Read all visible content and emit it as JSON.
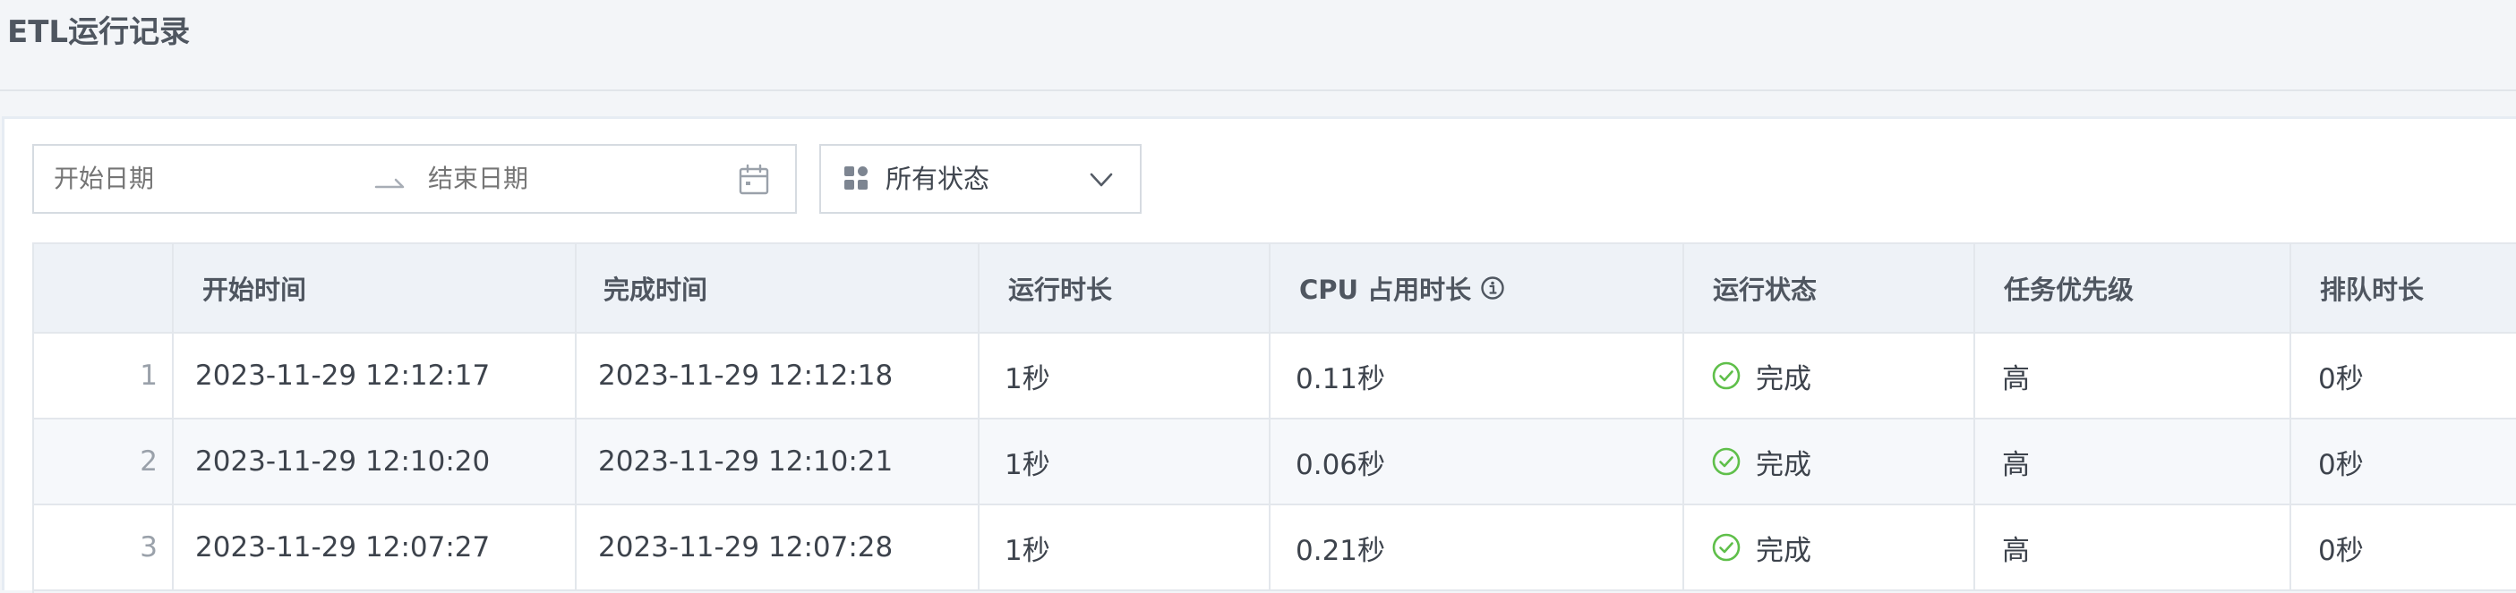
{
  "page": {
    "title": "ETL运行记录"
  },
  "filters": {
    "start_placeholder": "开始日期",
    "end_placeholder": "结束日期",
    "status_selected": "所有状态",
    "icons": {
      "date_separator": "arrow-right-icon",
      "calendar": "calendar-icon",
      "status": "apps-icon",
      "dropdown": "chevron-down-icon"
    }
  },
  "table": {
    "columns": {
      "start_time": "开始时间",
      "end_time": "完成时间",
      "duration": "运行时长",
      "cpu_time": "CPU 占用时长",
      "status": "运行状态",
      "priority": "任务优先级",
      "queue_time": "排队时长"
    },
    "rows": [
      {
        "index": "1",
        "start_time": "2023-11-29 12:12:17",
        "end_time": "2023-11-29 12:12:18",
        "duration": "1秒",
        "cpu_time": "0.11秒",
        "status": "完成",
        "priority": "高",
        "queue_time": "0秒"
      },
      {
        "index": "2",
        "start_time": "2023-11-29 12:10:20",
        "end_time": "2023-11-29 12:10:21",
        "duration": "1秒",
        "cpu_time": "0.06秒",
        "status": "完成",
        "priority": "高",
        "queue_time": "0秒"
      },
      {
        "index": "3",
        "start_time": "2023-11-29 12:07:27",
        "end_time": "2023-11-29 12:07:28",
        "duration": "1秒",
        "cpu_time": "0.21秒",
        "status": "完成",
        "priority": "高",
        "queue_time": "0秒"
      }
    ]
  },
  "colors": {
    "success": "#5fbf4a",
    "header_bg": "#eef2f7",
    "border": "#e3e7ec",
    "page_bg": "#f3f5f8"
  }
}
